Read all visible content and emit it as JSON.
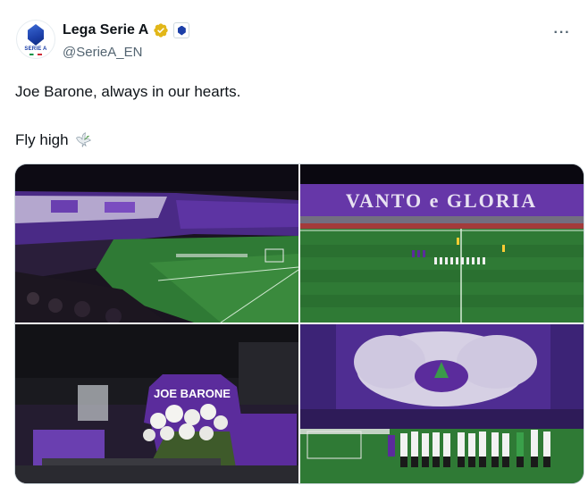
{
  "account": {
    "display_name": "Lega Serie A",
    "handle": "@SerieA_EN",
    "avatar_text": "SERIE A"
  },
  "tweet": {
    "line1": "Joe Barone, always in our hearts.",
    "line2": "Fly high"
  },
  "photos": [
    {
      "label": "Stadium overview with purple and white banners"
    },
    {
      "banner_text": "VANTO e GLORIA"
    },
    {
      "jersey_text": "JOE BARONE"
    },
    {
      "label": "Team lined up before fan choreography"
    }
  ],
  "icons": {
    "verified": "verified-badge-icon",
    "affiliate": "serie-a-affiliate-icon",
    "more": "more-options-icon",
    "dove": "dove-icon"
  },
  "colors": {
    "fiorentina_purple": "#5b2c9c",
    "pitch_green": "#2f7a35",
    "verified_gold": "#e2b719",
    "text_primary": "#0f1419",
    "text_secondary": "#536471"
  }
}
